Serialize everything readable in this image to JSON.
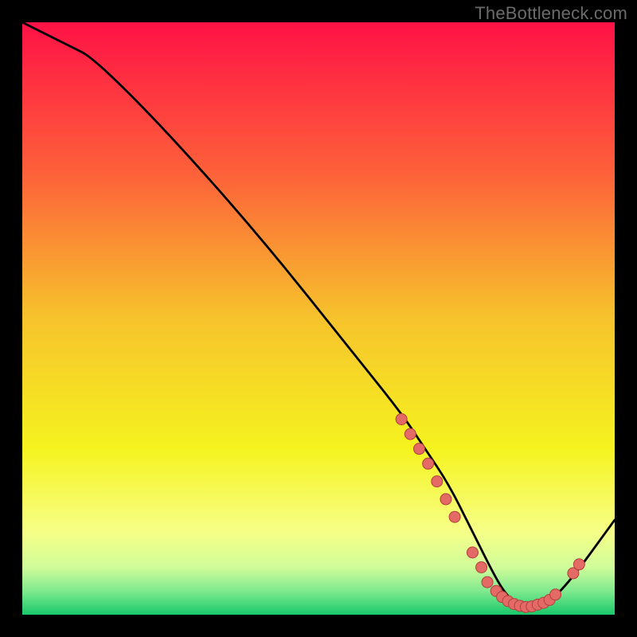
{
  "watermark": "TheBottleneck.com",
  "chart_data": {
    "type": "line",
    "title": "",
    "xlabel": "",
    "ylabel": "",
    "xlim": [
      0,
      100
    ],
    "ylim": [
      0,
      100
    ],
    "grid": false,
    "gradient_stops": [
      {
        "offset": 0.0,
        "color": "#ff1246"
      },
      {
        "offset": 0.25,
        "color": "#fd5f3a"
      },
      {
        "offset": 0.5,
        "color": "#f6c32c"
      },
      {
        "offset": 0.72,
        "color": "#f5f31f"
      },
      {
        "offset": 0.86,
        "color": "#f6ff87"
      },
      {
        "offset": 0.92,
        "color": "#d0fc9a"
      },
      {
        "offset": 0.96,
        "color": "#7fe98e"
      },
      {
        "offset": 1.0,
        "color": "#19c86a"
      }
    ],
    "curve": {
      "x": [
        0,
        4,
        8,
        12,
        24,
        40,
        56,
        64,
        68,
        72,
        76,
        80,
        82,
        84,
        86,
        88,
        92,
        100
      ],
      "y": [
        100,
        98,
        96,
        94,
        82,
        64,
        44,
        34,
        28,
        22,
        14,
        6,
        3,
        1.5,
        1.2,
        1.5,
        5,
        16
      ]
    },
    "markers": [
      {
        "x": 64.0,
        "y": 33.0
      },
      {
        "x": 65.5,
        "y": 30.5
      },
      {
        "x": 67.0,
        "y": 28.0
      },
      {
        "x": 68.5,
        "y": 25.5
      },
      {
        "x": 70.0,
        "y": 22.5
      },
      {
        "x": 71.5,
        "y": 19.5
      },
      {
        "x": 73.0,
        "y": 16.5
      },
      {
        "x": 76.0,
        "y": 10.5
      },
      {
        "x": 77.5,
        "y": 8.0
      },
      {
        "x": 78.5,
        "y": 5.5
      },
      {
        "x": 80.0,
        "y": 4.0
      },
      {
        "x": 81.0,
        "y": 3.0
      },
      {
        "x": 82.0,
        "y": 2.3
      },
      {
        "x": 83.0,
        "y": 1.8
      },
      {
        "x": 84.0,
        "y": 1.5
      },
      {
        "x": 85.0,
        "y": 1.3
      },
      {
        "x": 86.0,
        "y": 1.4
      },
      {
        "x": 87.0,
        "y": 1.7
      },
      {
        "x": 88.0,
        "y": 2.0
      },
      {
        "x": 89.0,
        "y": 2.5
      },
      {
        "x": 90.0,
        "y": 3.4
      },
      {
        "x": 93.0,
        "y": 7.0
      },
      {
        "x": 94.0,
        "y": 8.5
      }
    ],
    "marker_style": {
      "r": 7,
      "fill": "#e46a66",
      "stroke": "#b33f3c",
      "stroke_width": 1
    },
    "line_style": {
      "stroke": "#000000",
      "width": 2.8
    }
  }
}
